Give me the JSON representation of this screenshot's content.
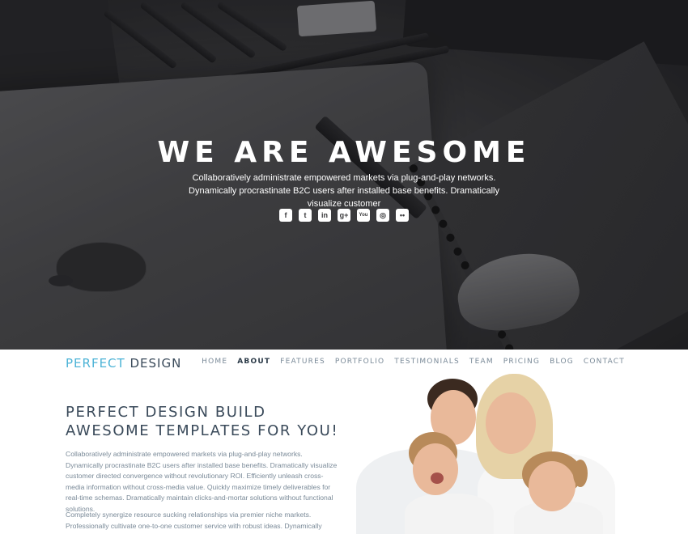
{
  "hero": {
    "title": "WE ARE AWESOME",
    "subtitle": "Collaboratively administrate empowered markets via plug-and-play networks. Dynamically procrastinate B2C users after installed base benefits. Dramatically visualize customer",
    "social": [
      {
        "name": "facebook-icon",
        "glyph": "f"
      },
      {
        "name": "twitter-icon",
        "glyph": "t"
      },
      {
        "name": "linkedin-icon",
        "glyph": "in"
      },
      {
        "name": "google-plus-icon",
        "glyph": "g+"
      },
      {
        "name": "youtube-icon",
        "glyph": "You"
      },
      {
        "name": "instagram-icon",
        "glyph": "◎"
      },
      {
        "name": "flickr-icon",
        "glyph": "••"
      }
    ]
  },
  "navbar": {
    "brand_accent": "PERFECT",
    "brand_rest": "DESIGN",
    "brand_accent_color": "#4cb3d6",
    "items": [
      "HOME",
      "ABOUT",
      "FEATURES",
      "PORTFOLIO",
      "TESTIMONIALS",
      "TEAM",
      "PRICING",
      "BLOG",
      "CONTACT"
    ],
    "active_item": "ABOUT"
  },
  "about": {
    "title": "PERFECT DESIGN BUILD AWESOME TEMPLATES FOR YOU!",
    "paragraph1": "Collaboratively administrate empowered markets via plug-and-play networks. Dynamically procrastinate B2C users after installed base benefits. Dramatically visualize customer directed convergence without revolutionary ROI. Efficiently unleash cross-media information without cross-media value. Quickly maximize timely deliverables for real-time schemas. Dramatically maintain clicks-and-mortar solutions without functional solutions.",
    "paragraph2": "Completely synergize resource sucking relationships via premier niche markets. Professionally cultivate one-to-one customer service with robust ideas. Dynamically"
  }
}
